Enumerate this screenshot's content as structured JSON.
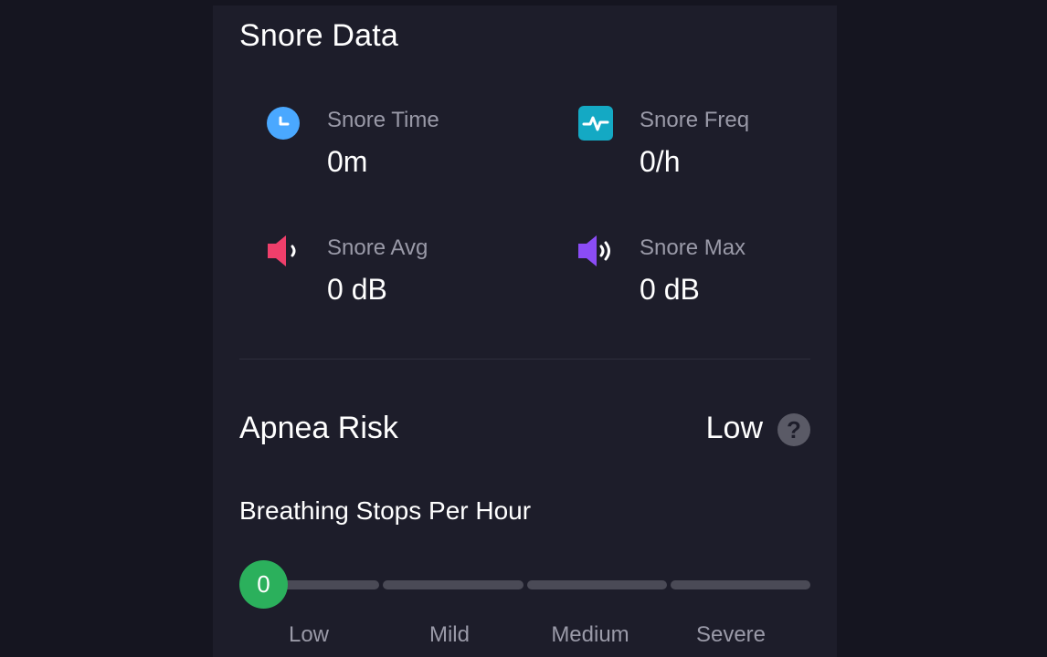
{
  "snore": {
    "title": "Snore Data",
    "stats": [
      {
        "label": "Snore Time",
        "value": "0m",
        "icon": "clock-icon",
        "color": "#4aa8ff"
      },
      {
        "label": "Snore Freq",
        "value": "0/h",
        "icon": "pulse-icon",
        "color": "#14a9c4"
      },
      {
        "label": "Snore Avg",
        "value": "0 dB",
        "icon": "speaker-low-icon",
        "color": "#ef3f6b"
      },
      {
        "label": "Snore Max",
        "value": "0 dB",
        "icon": "speaker-high-icon",
        "color": "#8b4cf6"
      }
    ]
  },
  "apnea": {
    "title": "Apnea Risk",
    "level": "Low",
    "help_icon": "help-icon",
    "subtitle": "Breathing Stops Per Hour",
    "current_value": "0",
    "thumb_color": "#2bb05c",
    "scale": [
      "Low",
      "Mild",
      "Medium",
      "Severe"
    ]
  }
}
